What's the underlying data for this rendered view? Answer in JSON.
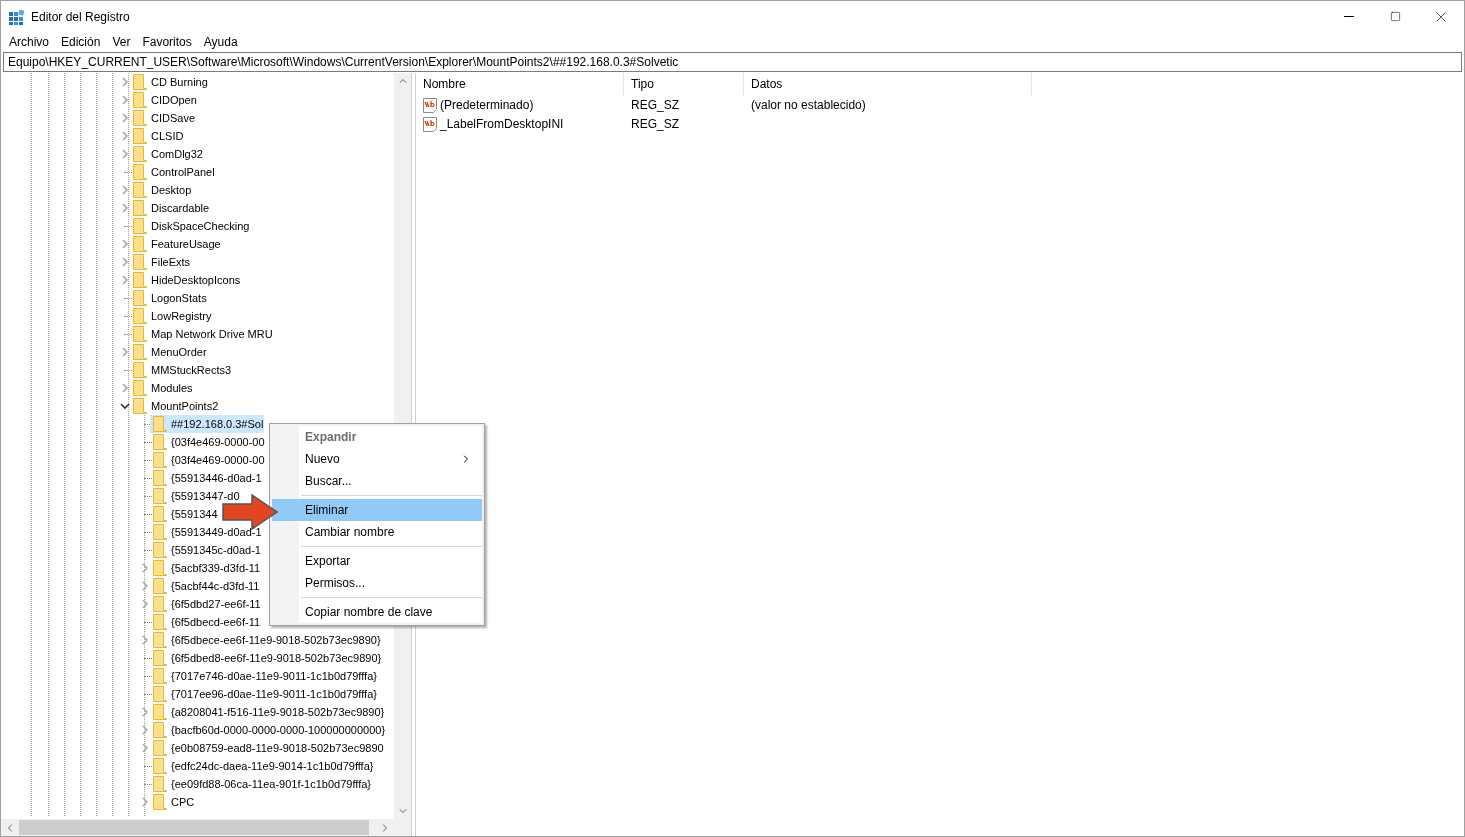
{
  "window": {
    "title": "Editor del Registro"
  },
  "menu_bar": [
    "Archivo",
    "Edición",
    "Ver",
    "Favoritos",
    "Ayuda"
  ],
  "address": "Equipo\\HKEY_CURRENT_USER\\Software\\Microsoft\\Windows\\CurrentVersion\\Explorer\\MountPoints2\\##192.168.0.3#Solvetic",
  "tree": {
    "items": [
      {
        "label": "CD Burning",
        "expandable": true,
        "expanded": false,
        "selected": false
      },
      {
        "label": "CIDOpen",
        "expandable": true,
        "expanded": false,
        "selected": false
      },
      {
        "label": "CIDSave",
        "expandable": true,
        "expanded": false,
        "selected": false
      },
      {
        "label": "CLSID",
        "expandable": true,
        "expanded": false,
        "selected": false
      },
      {
        "label": "ComDlg32",
        "expandable": true,
        "expanded": false,
        "selected": false
      },
      {
        "label": "ControlPanel",
        "expandable": false,
        "selected": false
      },
      {
        "label": "Desktop",
        "expandable": true,
        "expanded": false,
        "selected": false
      },
      {
        "label": "Discardable",
        "expandable": true,
        "expanded": false,
        "selected": false
      },
      {
        "label": "DiskSpaceChecking",
        "expandable": false,
        "selected": false
      },
      {
        "label": "FeatureUsage",
        "expandable": true,
        "expanded": false,
        "selected": false
      },
      {
        "label": "FileExts",
        "expandable": true,
        "expanded": false,
        "selected": false
      },
      {
        "label": "HideDesktopIcons",
        "expandable": true,
        "expanded": false,
        "selected": false
      },
      {
        "label": "LogonStats",
        "expandable": false,
        "selected": false
      },
      {
        "label": "LowRegistry",
        "expandable": false,
        "selected": false
      },
      {
        "label": "Map Network Drive MRU",
        "expandable": false,
        "selected": false
      },
      {
        "label": "MenuOrder",
        "expandable": true,
        "expanded": false,
        "selected": false
      },
      {
        "label": "MMStuckRects3",
        "expandable": false,
        "selected": false
      },
      {
        "label": "Modules",
        "expandable": true,
        "expanded": false,
        "selected": false
      },
      {
        "label": "MountPoints2",
        "expandable": true,
        "expanded": true,
        "selected": false,
        "children": [
          {
            "label": "##192.168.0.3#Sol",
            "expandable": false,
            "selected": true
          },
          {
            "label": "{03f4e469-0000-00",
            "expandable": false,
            "selected": false
          },
          {
            "label": "{03f4e469-0000-00",
            "expandable": false,
            "selected": false
          },
          {
            "label": "{55913446-d0ad-1",
            "expandable": false,
            "selected": false
          },
          {
            "label": "{55913447-d0",
            "expandable": false,
            "selected": false
          },
          {
            "label": "{5591344",
            "expandable": false,
            "selected": false
          },
          {
            "label": "{55913449-d0ad-1",
            "expandable": false,
            "selected": false
          },
          {
            "label": "{5591345c-d0ad-1",
            "expandable": false,
            "selected": false
          },
          {
            "label": "{5acbf339-d3fd-11",
            "expandable": true,
            "expanded": false,
            "selected": false
          },
          {
            "label": "{5acbf44c-d3fd-11",
            "expandable": true,
            "expanded": false,
            "selected": false
          },
          {
            "label": "{6f5dbd27-ee6f-11",
            "expandable": true,
            "expanded": false,
            "selected": false
          },
          {
            "label": "{6f5dbecd-ee6f-11",
            "expandable": false,
            "selected": false
          },
          {
            "label": "{6f5dbece-ee6f-11e9-9018-502b73ec9890}",
            "expandable": true,
            "expanded": false,
            "selected": false
          },
          {
            "label": "{6f5dbed8-ee6f-11e9-9018-502b73ec9890}",
            "expandable": false,
            "selected": false
          },
          {
            "label": "{7017e746-d0ae-11e9-9011-1c1b0d79fffa}",
            "expandable": false,
            "selected": false
          },
          {
            "label": "{7017ee96-d0ae-11e9-9011-1c1b0d79fffa}",
            "expandable": false,
            "selected": false
          },
          {
            "label": "{a8208041-f516-11e9-9018-502b73ec9890}",
            "expandable": true,
            "expanded": false,
            "selected": false
          },
          {
            "label": "{bacfb60d-0000-0000-0000-100000000000}",
            "expandable": true,
            "expanded": false,
            "selected": false
          },
          {
            "label": "{e0b08759-ead8-11e9-9018-502b73ec9890",
            "expandable": true,
            "expanded": false,
            "selected": false
          },
          {
            "label": "{edfc24dc-daea-11e9-9014-1c1b0d79fffa}",
            "expandable": false,
            "selected": false
          },
          {
            "label": "{ee09fd88-06ca-11ea-901f-1c1b0d79fffa}",
            "expandable": false,
            "selected": false
          },
          {
            "label": "CPC",
            "expandable": true,
            "expanded": false,
            "selected": false
          }
        ]
      }
    ]
  },
  "values": {
    "columns": [
      "Nombre",
      "Tipo",
      "Datos"
    ],
    "rows": [
      {
        "name": "(Predeterminado)",
        "type": "REG_SZ",
        "data": "(valor no establecido)"
      },
      {
        "name": "_LabelFromDesktopINI",
        "type": "REG_SZ"
      }
    ]
  },
  "context_menu": {
    "items": [
      {
        "kind": "item",
        "label": "Expandir",
        "disabled": true,
        "selected": false,
        "submenu": false
      },
      {
        "kind": "item",
        "label": "Nuevo",
        "disabled": false,
        "selected": false,
        "submenu": true
      },
      {
        "kind": "item",
        "label": "Buscar...",
        "disabled": false,
        "selected": false,
        "submenu": false
      },
      {
        "kind": "separator"
      },
      {
        "kind": "item",
        "label": "Eliminar",
        "disabled": false,
        "selected": true,
        "submenu": false
      },
      {
        "kind": "item",
        "label": "Cambiar nombre",
        "disabled": false,
        "selected": false,
        "submenu": false
      },
      {
        "kind": "separator"
      },
      {
        "kind": "item",
        "label": "Exportar",
        "disabled": false,
        "selected": false,
        "submenu": false
      },
      {
        "kind": "item",
        "label": "Permisos...",
        "disabled": false,
        "selected": false,
        "submenu": false
      },
      {
        "kind": "separator"
      },
      {
        "kind": "item",
        "label": "Copiar nombre de clave",
        "disabled": false,
        "selected": false,
        "submenu": false
      }
    ]
  }
}
